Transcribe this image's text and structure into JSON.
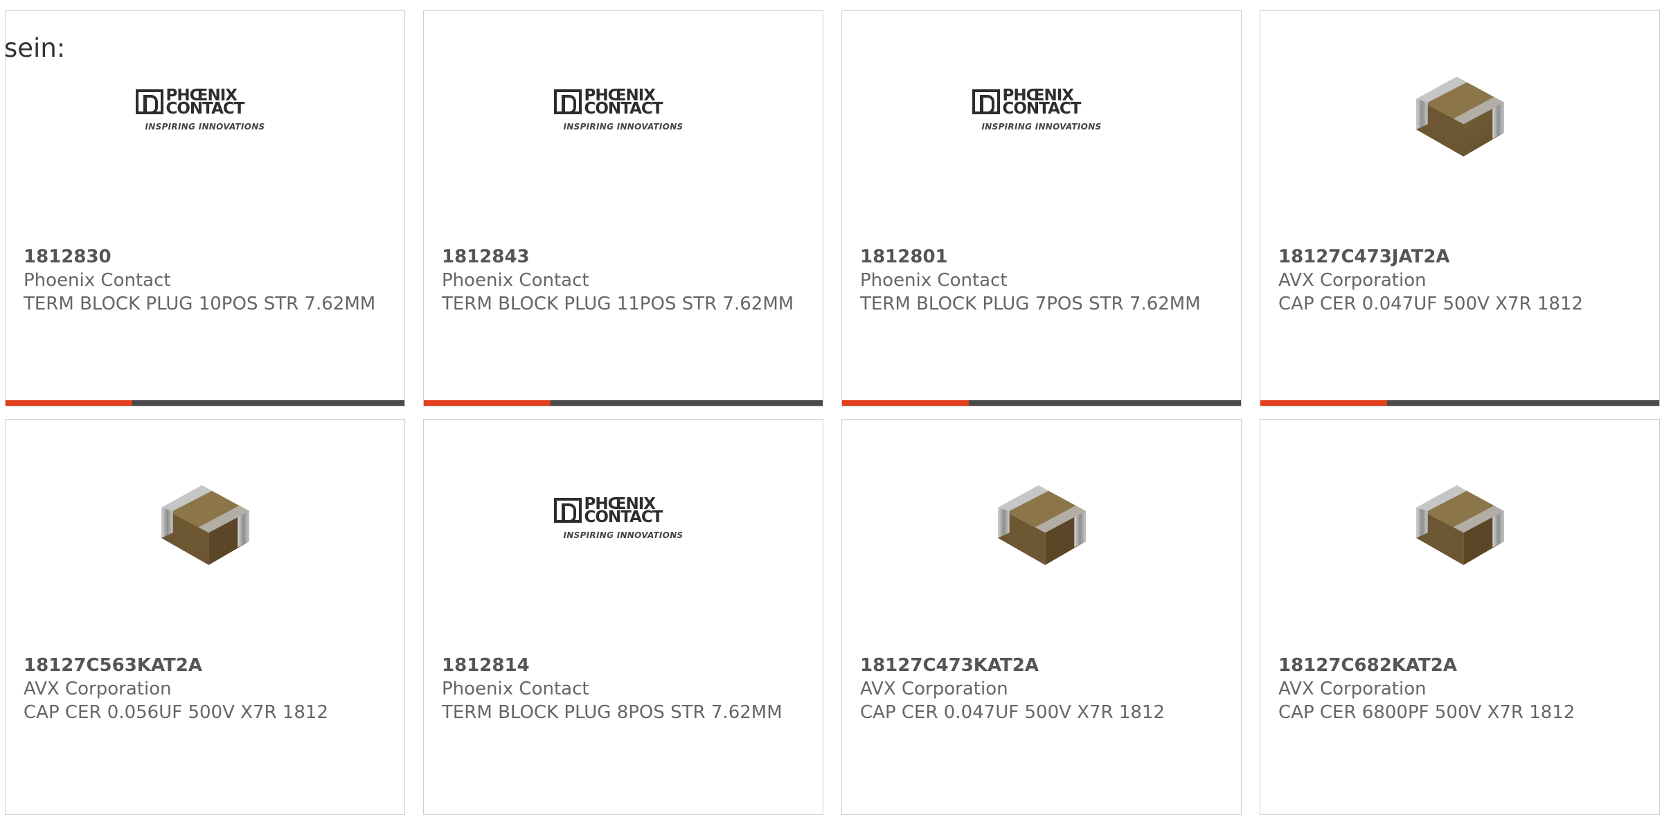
{
  "intro_text": "sein:",
  "colors": {
    "accent_bar": "#e0401c",
    "bar": "#4a4a4a"
  },
  "logo": {
    "word1": "PHŒNIX",
    "word2": "CONTACT",
    "tagline": "INSPIRING INNOVATIONS"
  },
  "products": [
    {
      "part": "1812830",
      "manufacturer": "Phoenix Contact",
      "description": "TERM BLOCK PLUG 10POS STR 7.62MM",
      "image": "phoenix-contact-logo"
    },
    {
      "part": "1812843",
      "manufacturer": "Phoenix Contact",
      "description": "TERM BLOCK PLUG 11POS STR 7.62MM",
      "image": "phoenix-contact-logo"
    },
    {
      "part": "1812801",
      "manufacturer": "Phoenix Contact",
      "description": "TERM BLOCK PLUG 7POS STR 7.62MM",
      "image": "phoenix-contact-logo"
    },
    {
      "part": "18127C473JAT2A",
      "manufacturer": "AVX Corporation",
      "description": "CAP CER 0.047UF 500V X7R 1812",
      "image": "ceramic-capacitor-chip"
    },
    {
      "part": "18127C563KAT2A",
      "manufacturer": "AVX Corporation",
      "description": "CAP CER 0.056UF 500V X7R 1812",
      "image": "ceramic-capacitor-chip"
    },
    {
      "part": "1812814",
      "manufacturer": "Phoenix Contact",
      "description": "TERM BLOCK PLUG 8POS STR 7.62MM",
      "image": "phoenix-contact-logo"
    },
    {
      "part": "18127C473KAT2A",
      "manufacturer": "AVX Corporation",
      "description": "CAP CER 0.047UF 500V X7R 1812",
      "image": "ceramic-capacitor-chip"
    },
    {
      "part": "18127C682KAT2A",
      "manufacturer": "AVX Corporation",
      "description": "CAP CER 6800PF 500V X7R 1812",
      "image": "ceramic-capacitor-chip"
    }
  ]
}
